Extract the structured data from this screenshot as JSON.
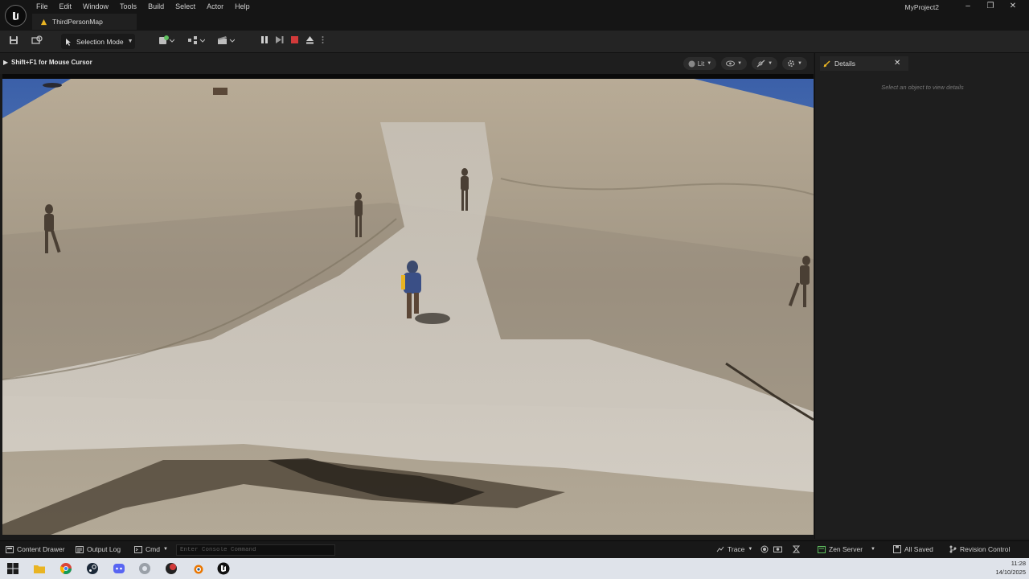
{
  "menubar": {
    "items": [
      "File",
      "Edit",
      "Window",
      "Tools",
      "Build",
      "Select",
      "Actor",
      "Help"
    ],
    "project_name": "MyProject2"
  },
  "level_tab": {
    "label": "ThirdPersonMap"
  },
  "toolbar": {
    "mode_label": "Selection Mode"
  },
  "viewport": {
    "hint": "Shift+F1 for Mouse Cursor",
    "view_mode": "Lit"
  },
  "details": {
    "tab_label": "Details",
    "empty_message": "Select an object to view details"
  },
  "statusbar": {
    "content_drawer": "Content Drawer",
    "output_log": "Output Log",
    "cmd_label": "Cmd",
    "console_placeholder": "Enter Console Command",
    "trace": "Trace",
    "zen_server": "Zen Server",
    "all_saved": "All Saved",
    "revision_control": "Revision Control"
  },
  "taskbar": {
    "time": "11:28",
    "date": "14/10/2025"
  },
  "colors": {
    "accent_yellow": "#e9b423",
    "stop_red": "#d23a3a",
    "play_green": "#5fbf5f"
  }
}
